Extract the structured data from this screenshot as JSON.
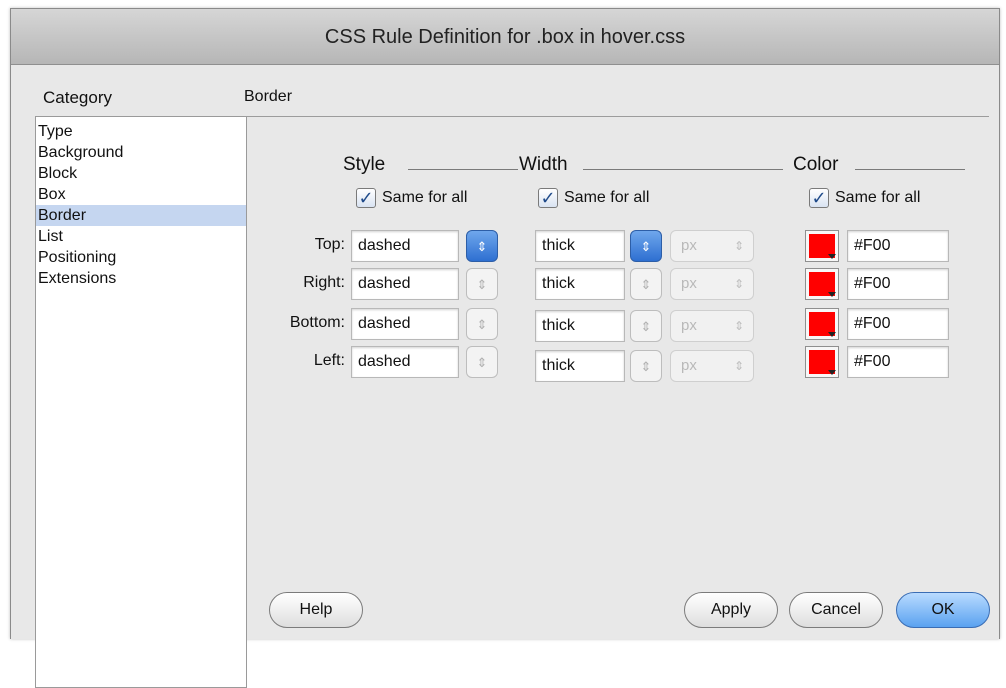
{
  "window": {
    "title": "CSS Rule Definition for .box in hover.css"
  },
  "category": {
    "heading": "Category",
    "items": [
      "Type",
      "Background",
      "Block",
      "Box",
      "Border",
      "List",
      "Positioning",
      "Extensions"
    ],
    "selected": "Border"
  },
  "panel": {
    "title": "Border",
    "columns": {
      "style": "Style",
      "width": "Width",
      "color": "Color"
    },
    "same_for_all_label": "Same for all",
    "rows": [
      {
        "label": "Top:",
        "style": "dashed",
        "width": "thick",
        "unit": "px",
        "color": "#F00"
      },
      {
        "label": "Right:",
        "style": "dashed",
        "width": "thick",
        "unit": "px",
        "color": "#F00"
      },
      {
        "label": "Bottom:",
        "style": "dashed",
        "width": "thick",
        "unit": "px",
        "color": "#F00"
      },
      {
        "label": "Left:",
        "style": "dashed",
        "width": "thick",
        "unit": "px",
        "color": "#F00"
      }
    ],
    "swatch_color": "#ff0000"
  },
  "buttons": {
    "help": "Help",
    "apply": "Apply",
    "cancel": "Cancel",
    "ok": "OK"
  }
}
